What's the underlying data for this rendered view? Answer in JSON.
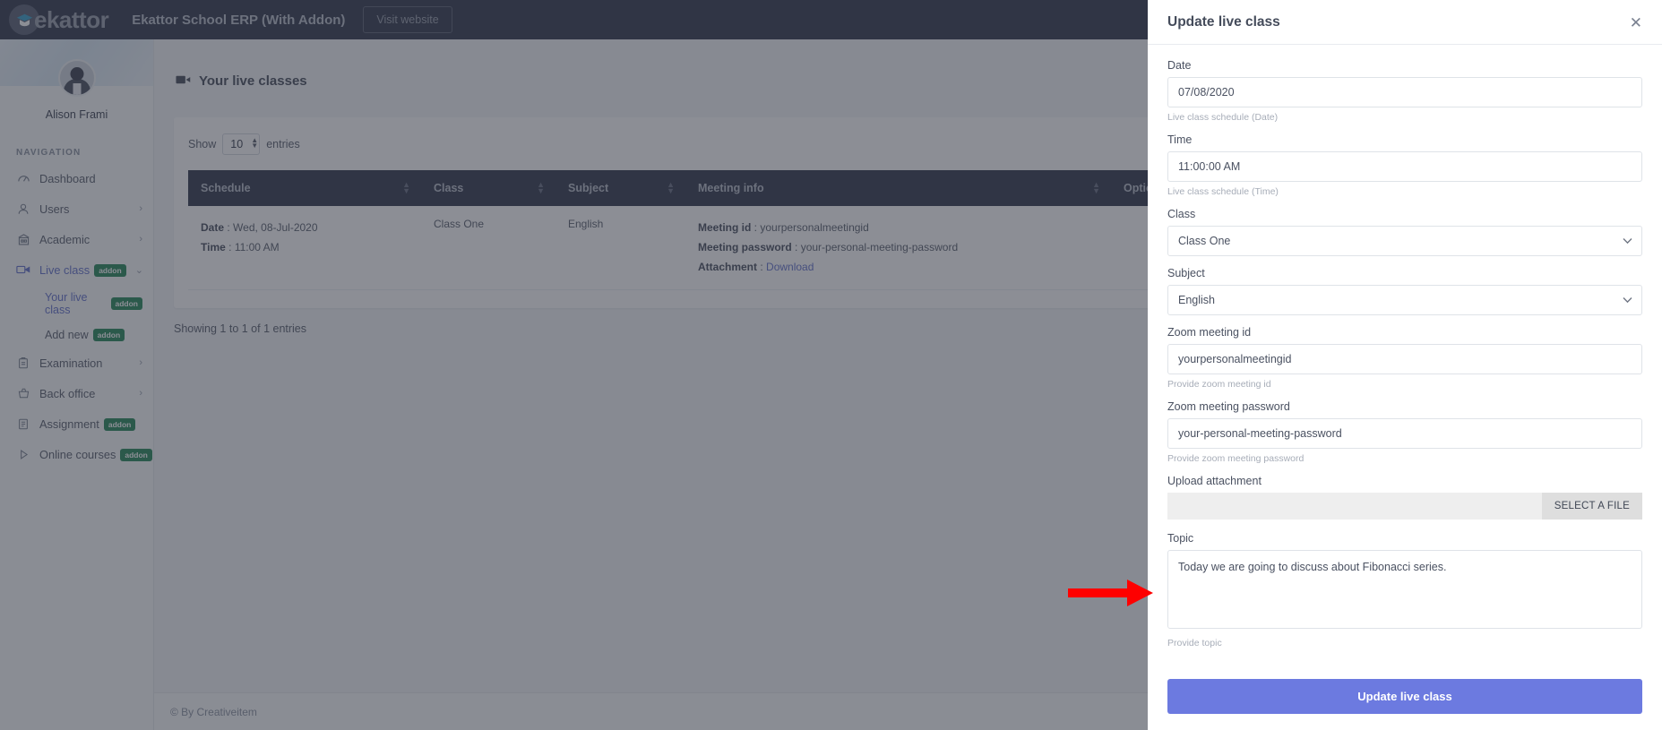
{
  "topbar": {
    "logo_text": "ekattor",
    "logo_icon": "graduation-cap-icon",
    "app_title": "Ekattor School ERP (With Addon)",
    "visit_label": "Visit website"
  },
  "sidebar": {
    "user_name": "Alison Frami",
    "nav_heading": "NAVIGATION",
    "items": [
      {
        "label": "Dashboard",
        "icon": "speedometer-icon",
        "chevron": "",
        "badge": "",
        "active": false
      },
      {
        "label": "Users",
        "icon": "user-icon",
        "chevron": "›",
        "badge": "",
        "active": false
      },
      {
        "label": "Academic",
        "icon": "bank-icon",
        "chevron": "›",
        "badge": "",
        "active": false
      },
      {
        "label": "Live class",
        "icon": "video-camera-icon",
        "chevron": "⌄",
        "badge": "addon",
        "active": true
      },
      {
        "label": "Examination",
        "icon": "clipboard-icon",
        "chevron": "›",
        "badge": "",
        "active": false
      },
      {
        "label": "Back office",
        "icon": "basket-icon",
        "chevron": "›",
        "badge": "",
        "active": false
      },
      {
        "label": "Assignment",
        "icon": "note-icon",
        "chevron": "",
        "badge": "addon",
        "active": false
      },
      {
        "label": "Online courses",
        "icon": "play-icon",
        "chevron": "",
        "badge": "addon",
        "active": false
      }
    ],
    "sub_items": [
      {
        "label": "Your live class",
        "badge": "addon",
        "active": true
      },
      {
        "label": "Add new",
        "badge": "addon",
        "active": false
      }
    ]
  },
  "main": {
    "page_title": "Your live classes",
    "page_icon": "video-camera-icon",
    "show_label": "Show",
    "show_value": "10",
    "entries_label": "entries",
    "columns": [
      "Schedule",
      "Class",
      "Subject",
      "Meeting info",
      "Options"
    ],
    "rows": [
      {
        "schedule_date_label": "Date",
        "schedule_date_value": "Wed, 08-Jul-2020",
        "schedule_time_label": "Time",
        "schedule_time_value": "11:00 AM",
        "class": "Class One",
        "subject": "English",
        "meeting_id_label": "Meeting id",
        "meeting_id_value": "yourpersonalmeetingid",
        "meeting_password_label": "Meeting password",
        "meeting_password_value": "your-personal-meeting-password",
        "attachment_label": "Attachment",
        "attachment_link": "Download"
      }
    ],
    "showing_text": "Showing 1 to 1 of 1 entries",
    "footer_text": "© By Creativeitem"
  },
  "drawer": {
    "title": "Update live class",
    "close_icon": "close-icon",
    "fields": {
      "date": {
        "label": "Date",
        "value": "07/08/2020",
        "help": "Live class schedule (Date)"
      },
      "time": {
        "label": "Time",
        "value": "11:00:00 AM",
        "help": "Live class schedule (Time)"
      },
      "class": {
        "label": "Class",
        "value": "Class One"
      },
      "subject": {
        "label": "Subject",
        "value": "English"
      },
      "zoom_meeting_id": {
        "label": "Zoom meeting id",
        "value": "yourpersonalmeetingid",
        "help": "Provide zoom meeting id"
      },
      "zoom_meeting_password": {
        "label": "Zoom meeting password",
        "value": "your-personal-meeting-password",
        "help": "Provide zoom meeting password"
      },
      "upload": {
        "label": "Upload attachment",
        "button": "SELECT A FILE",
        "value": ""
      },
      "topic": {
        "label": "Topic",
        "value": "Today we are going to discuss about Fibonacci series.",
        "help": "Provide topic"
      }
    },
    "submit_label": "Update live class",
    "accent_color": "#6c7ae0"
  },
  "annotation": {
    "arrow_color": "#fe0000",
    "name": "red-arrow-pointing-to-update-button"
  }
}
